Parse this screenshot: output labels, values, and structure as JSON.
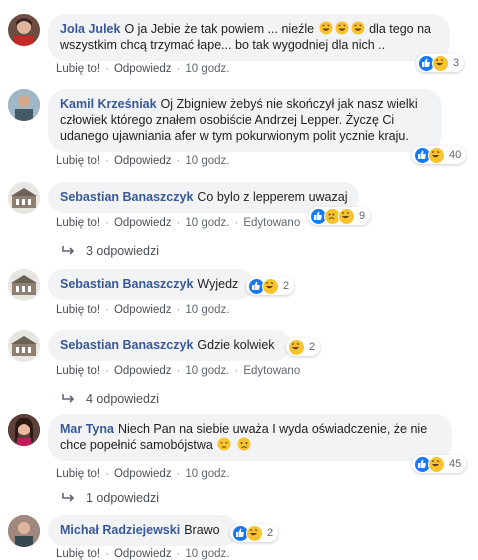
{
  "comments": [
    {
      "author": "Jola Julek",
      "text_before": "O ja Jebie że tak powiem ... nieźle",
      "text_after": "dla tego na wszystkim chcą trzymać łape... bo tak wygodniej dla nich ..",
      "like": "Lubię to!",
      "reply": "Odpowiedz",
      "time": "10 godz.",
      "reactions": "3"
    },
    {
      "author": "Kamil Krześniak",
      "text": "Oj Zbigniew żebyś nie skończył jak nasz wielki człowiek którego znałem osobiście Andrzej Lepper. Życzę Ci udanego ujawniania afer w tym pokurwionym polit ycznie kraju.",
      "like": "Lubię to!",
      "reply": "Odpowiedz",
      "time": "10 godz.",
      "reactions": "40"
    },
    {
      "author": "Sebastian Banaszczyk",
      "text": "Co bylo z lepperem uwazaj",
      "like": "Lubię to!",
      "reply": "Odpowiedz",
      "time": "10 godz.",
      "edited": "Edytowano",
      "reactions": "9",
      "replies": "3 odpowiedzi"
    },
    {
      "author": "Sebastian Banaszczyk",
      "text": "Wyjedz",
      "like": "Lubię to!",
      "reply": "Odpowiedz",
      "time": "10 godz.",
      "reactions": "2"
    },
    {
      "author": "Sebastian Banaszczyk",
      "text": "Gdzie kolwiek",
      "like": "Lubię to!",
      "reply": "Odpowiedz",
      "time": "10 godz.",
      "edited": "Edytowano",
      "reactions": "2",
      "replies": "4 odpowiedzi"
    },
    {
      "author": "Mar Tyna",
      "text": "Niech Pan na siebie uważa I wyda oświadczenie, że nie chce popełnić samobójstwa",
      "like": "Lubię to!",
      "reply": "Odpowiedz",
      "time": "10 godz.",
      "reactions": "45",
      "replies": "1 odpowiedzi"
    },
    {
      "author": "Michał Radziejewski",
      "text": "Brawo",
      "like": "Lubię to!",
      "reply": "Odpowiedz",
      "time": "10 godz.",
      "reactions": "2"
    }
  ],
  "colors": {
    "author": "#385898",
    "bubble": "#f2f3f5",
    "like": "#1877f2",
    "haha": "#f7c32e"
  }
}
